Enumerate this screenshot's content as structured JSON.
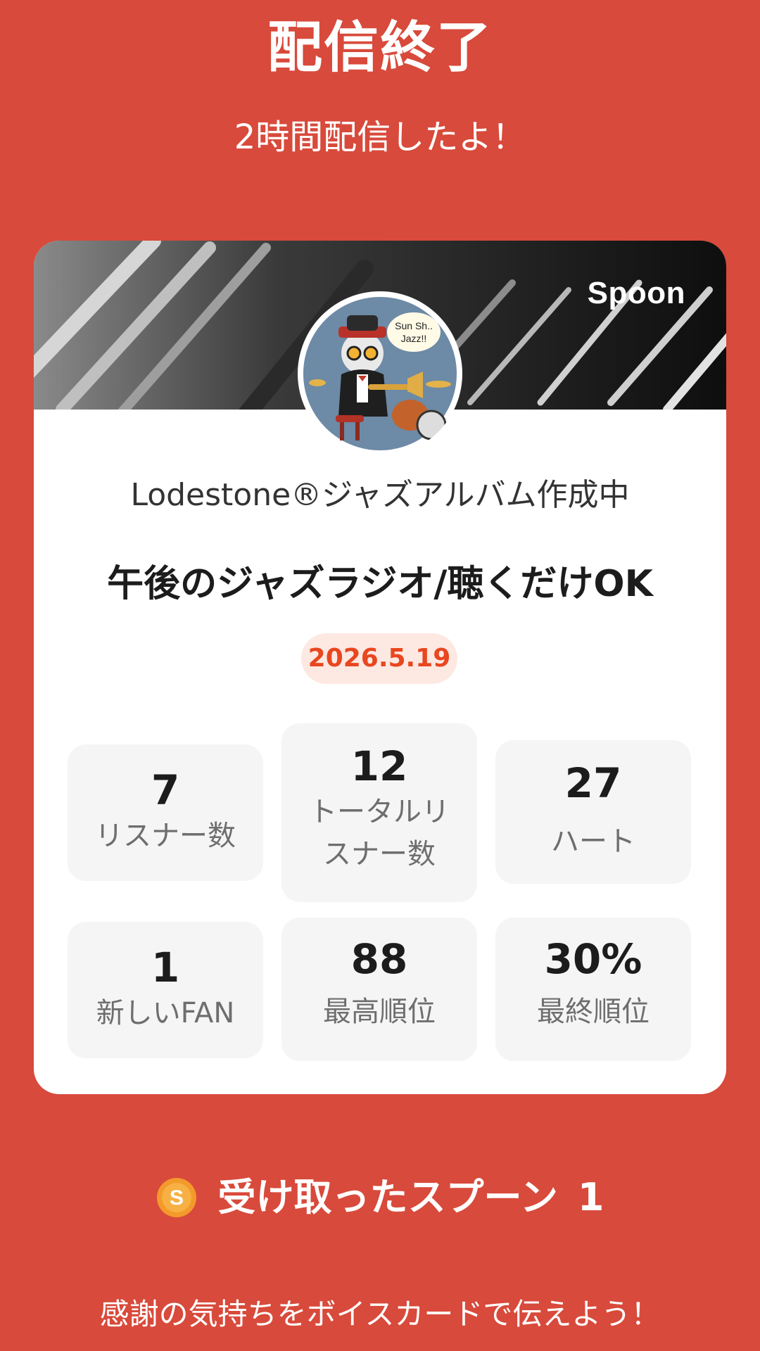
{
  "header": {
    "title": "配信終了",
    "subtitle": "2時間配信したよ！"
  },
  "card": {
    "brand": "Spoon",
    "avatar_icon": "cat-jazz-avatar",
    "avatar_text": "Sun Sh.. Jazz!!",
    "host_name": "Lodestone®ジャズアルバム作成中",
    "show_title": "午後のジャズラジオ/聴くだけOK",
    "date": "2026.5.19",
    "stats": [
      {
        "value": "7",
        "label": "リスナー数"
      },
      {
        "value": "12",
        "label": "トータルリスナー数"
      },
      {
        "value": "27",
        "label": "ハート"
      },
      {
        "value": "1",
        "label": "新しいFAN"
      },
      {
        "value": "88",
        "label": "最高順位"
      },
      {
        "value": "30%",
        "label": "最終順位"
      }
    ]
  },
  "spoons": {
    "icon": "spoon-coin-icon",
    "label": "受け取ったスプーン",
    "count": "1"
  },
  "footer": {
    "message": "感謝の気持ちをボイスカードで伝えよう！"
  },
  "colors": {
    "background": "#d84a3b",
    "card": "#ffffff",
    "stat_tile": "#f5f5f5",
    "date_text": "#e8471f",
    "date_bg": "#fde8e2",
    "coin": "#f39a2b"
  }
}
